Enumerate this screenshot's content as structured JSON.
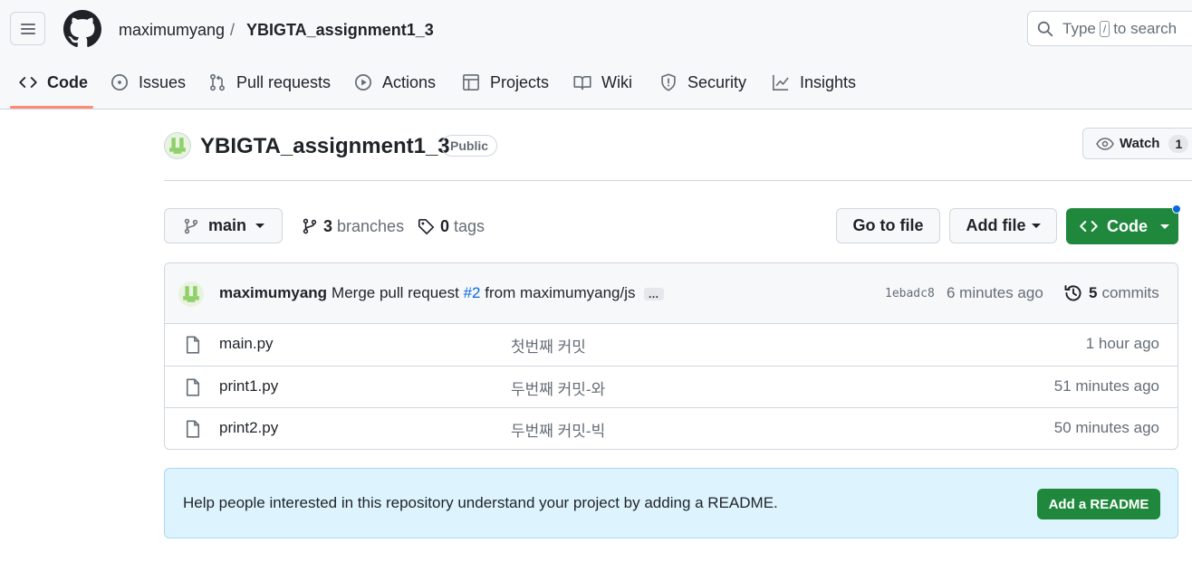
{
  "header": {
    "owner": "maximumyang",
    "separator": "/",
    "repo": "YBIGTA_assignment1_3",
    "search": {
      "prefix": "Type",
      "key": "/",
      "suffix": "to search"
    }
  },
  "tabs": [
    {
      "label": "Code",
      "icon": "code-icon",
      "selected": true
    },
    {
      "label": "Issues",
      "icon": "issue-icon"
    },
    {
      "label": "Pull requests",
      "icon": "pull-request-icon"
    },
    {
      "label": "Actions",
      "icon": "play-icon"
    },
    {
      "label": "Projects",
      "icon": "table-icon"
    },
    {
      "label": "Wiki",
      "icon": "book-icon"
    },
    {
      "label": "Security",
      "icon": "shield-icon"
    },
    {
      "label": "Insights",
      "icon": "graph-icon"
    }
  ],
  "repo": {
    "title": "YBIGTA_assignment1_3",
    "visibility": "Public",
    "watch_label": "Watch",
    "watch_count": "1"
  },
  "toolbar": {
    "branch": "main",
    "branches_count": "3",
    "branches_label": "branches",
    "tags_count": "0",
    "tags_label": "tags",
    "go_to_file": "Go to file",
    "add_file": "Add file",
    "code": "Code"
  },
  "latest_commit": {
    "author": "maximumyang",
    "message_before": "Merge pull request",
    "pr": "#2",
    "message_after": "from maximumyang/js",
    "ellipsis": "…",
    "sha": "1ebadc8",
    "time": "6 minutes ago",
    "commits_count": "5",
    "commits_label": "commits"
  },
  "files": [
    {
      "name": "main.py",
      "message": "첫번째 커밋",
      "time": "1 hour ago"
    },
    {
      "name": "print1.py",
      "message": "두번째 커밋-와",
      "time": "51 minutes ago"
    },
    {
      "name": "print2.py",
      "message": "두번째 커밋-빅",
      "time": "50 minutes ago"
    }
  ],
  "readme": {
    "text": "Help people interested in this repository understand your project by adding a README.",
    "button": "Add a README"
  },
  "colors": {
    "accent_green": "#1f883d",
    "link_blue": "#0969da",
    "tab_underline": "#fd8c73",
    "banner_bg": "#ddf4ff"
  }
}
